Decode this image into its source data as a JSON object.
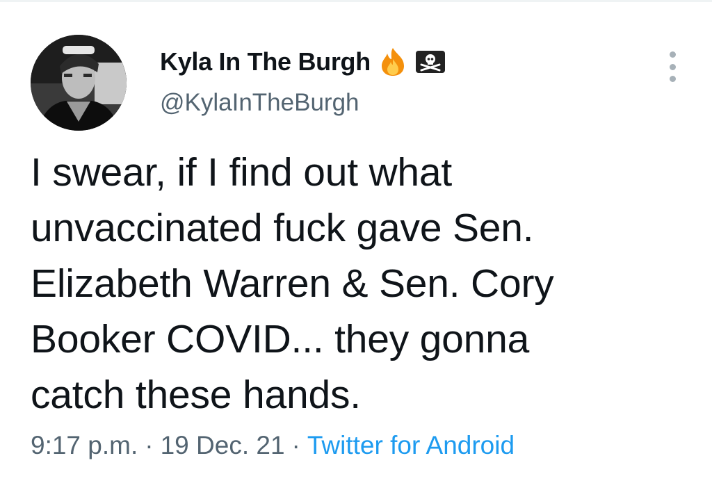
{
  "tweet": {
    "author": {
      "display_name": "Kyla In The Burgh",
      "name_emojis": [
        "fire-icon",
        "pirate-flag-icon"
      ],
      "handle": "@KylaInTheBurgh",
      "avatar": "avatar-photo"
    },
    "text_lines": [
      "I swear, if I find out what",
      "unvaccinated fuck gave Sen.",
      "Elizabeth Warren & Sen. Cory",
      "Booker COVID... they gonna",
      "catch these hands."
    ],
    "time": "9:17 p.m.",
    "separator": "·",
    "date": "19 Dec. 21",
    "source": "Twitter for Android"
  },
  "colors": {
    "text": "#0f1419",
    "secondary": "#536471",
    "link": "#1d9bf0"
  }
}
